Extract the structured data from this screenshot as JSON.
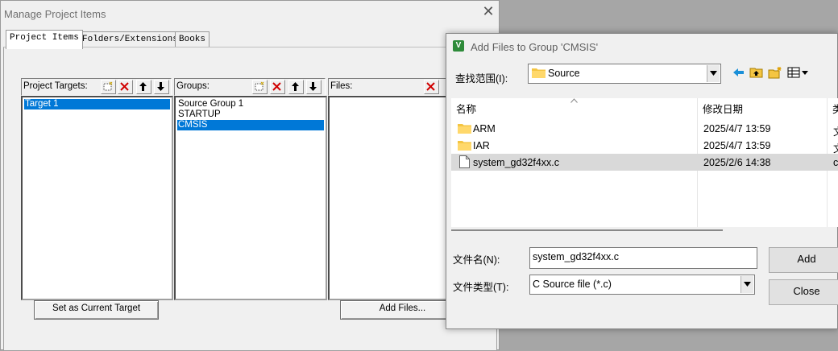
{
  "manage_dialog": {
    "title": "Manage Project Items",
    "tabs": [
      "Project Items",
      "Folders/Extensions",
      "Books"
    ],
    "targets": {
      "label": "Project Targets:",
      "items": [
        "Target 1"
      ],
      "selected": "Target 1"
    },
    "groups": {
      "label": "Groups:",
      "items": [
        "Source Group 1",
        "STARTUP",
        "CMSIS"
      ],
      "selected": "CMSIS"
    },
    "files": {
      "label": "Files:",
      "items": []
    },
    "set_target_button": "Set as Current Target",
    "add_files_button": "Add Files..."
  },
  "add_dialog": {
    "title": "Add Files to Group 'CMSIS'",
    "look_in_label": "查找范围(I):",
    "look_in_value": "Source",
    "columns": {
      "name": "名称",
      "date": "修改日期",
      "type": "类"
    },
    "rows": [
      {
        "name": "ARM",
        "date": "2025/4/7 13:59",
        "type": "文",
        "icon": "folder-icon"
      },
      {
        "name": "IAR",
        "date": "2025/4/7 13:59",
        "type": "文",
        "icon": "folder-icon"
      },
      {
        "name": "system_gd32f4xx.c",
        "date": "2025/2/6 14:38",
        "type": "c",
        "icon": "file-icon"
      }
    ],
    "filename_label": "文件名(N):",
    "filename_value": "system_gd32f4xx.c",
    "filetype_label": "文件类型(T):",
    "filetype_value": "C Source file (*.c)",
    "add_button": "Add",
    "close_button": "Close"
  }
}
